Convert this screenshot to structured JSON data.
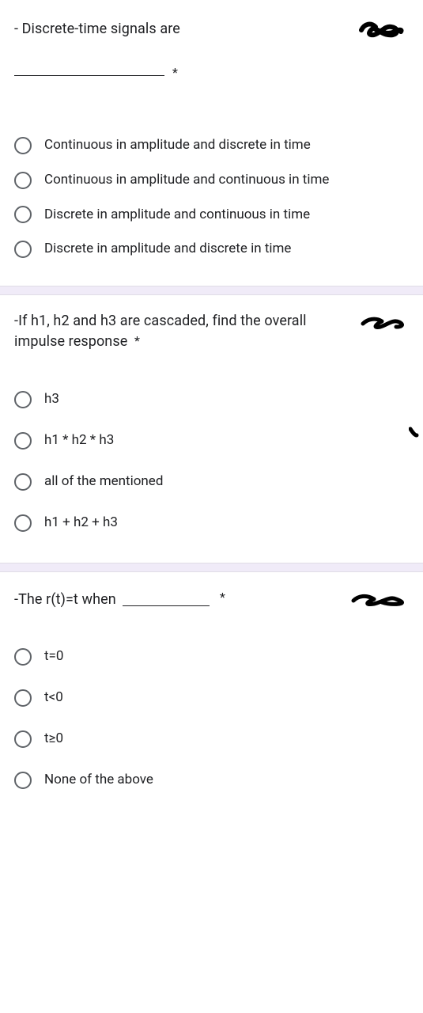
{
  "questions": [
    {
      "id": "q1",
      "title_prefix": "- Discrete-time signals are",
      "required_marker": "*",
      "options": [
        "Continuous in amplitude and discrete in time",
        "Continuous in amplitude and continuous in time",
        "Discrete in amplitude and continuous in time",
        "Discrete in amplitude and discrete in time"
      ]
    },
    {
      "id": "q2",
      "title": "-If h1, h2 and h3 are cascaded, find the overall impulse response",
      "required_marker": "*",
      "options": [
        "h3",
        "h1 * h2 * h3",
        "all of the mentioned",
        "h1 + h2 + h3"
      ]
    },
    {
      "id": "q3",
      "title_prefix": "-The r(t)=t when",
      "required_marker": "*",
      "options": [
        "t=0",
        "t<0",
        "t≥0",
        "None of the above"
      ]
    }
  ]
}
